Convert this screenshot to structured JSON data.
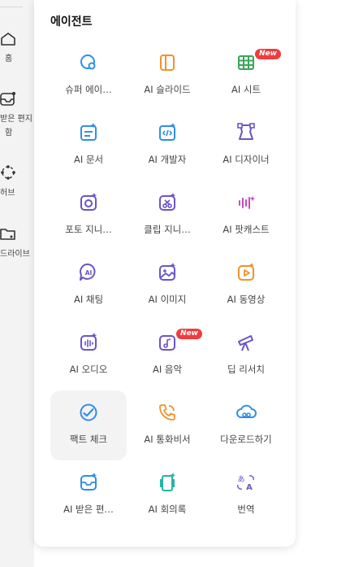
{
  "sidebar": {
    "items": [
      {
        "label": "홈",
        "icon": "home-icon"
      },
      {
        "label": "받은 편지함",
        "label_line1": "받은 편지",
        "label_line2": "함",
        "icon": "inbox-icon"
      },
      {
        "label": "허브",
        "icon": "hub-icon"
      },
      {
        "label": "드라이브",
        "icon": "drive-icon"
      }
    ]
  },
  "panel": {
    "title": "에이전트",
    "new_badge": "New",
    "agents": [
      {
        "label": "슈퍼 에이…",
        "icon": "super-agent-icon"
      },
      {
        "label": "AI 슬라이드",
        "icon": "slides-icon"
      },
      {
        "label": "AI 시트",
        "icon": "sheets-icon",
        "badge": true
      },
      {
        "label": "AI 문서",
        "icon": "docs-icon"
      },
      {
        "label": "AI 개발자",
        "icon": "developer-icon"
      },
      {
        "label": "AI 디자이너",
        "icon": "designer-icon"
      },
      {
        "label": "포토 지니…",
        "icon": "photo-genie-icon"
      },
      {
        "label": "클립 지니…",
        "icon": "clip-genie-icon"
      },
      {
        "label": "AI 팟캐스트",
        "icon": "podcast-icon"
      },
      {
        "label": "AI 채팅",
        "icon": "chat-icon"
      },
      {
        "label": "AI 이미지",
        "icon": "image-icon"
      },
      {
        "label": "AI 동영상",
        "icon": "video-icon"
      },
      {
        "label": "AI 오디오",
        "icon": "audio-icon"
      },
      {
        "label": "AI 음악",
        "icon": "music-icon",
        "badge": true
      },
      {
        "label": "딥 리서치",
        "icon": "telescope-icon"
      },
      {
        "label": "팩트 체크",
        "icon": "fact-check-icon",
        "active": true
      },
      {
        "label": "AI 통화비서",
        "icon": "call-assistant-icon"
      },
      {
        "label": "다운로드하기",
        "icon": "cloud-download-icon"
      },
      {
        "label": "AI 받은 편…",
        "icon": "ai-inbox-icon"
      },
      {
        "label": "AI 회의록",
        "icon": "meeting-notes-icon"
      },
      {
        "label": "번역",
        "icon": "translate-icon"
      }
    ]
  },
  "colors": {
    "blue": "#2f8fe8",
    "orange": "#f0922b",
    "green": "#3aa657",
    "purple": "#6a55c8",
    "pink": "#c44cc8",
    "badge_red": "#ef3d3d"
  }
}
